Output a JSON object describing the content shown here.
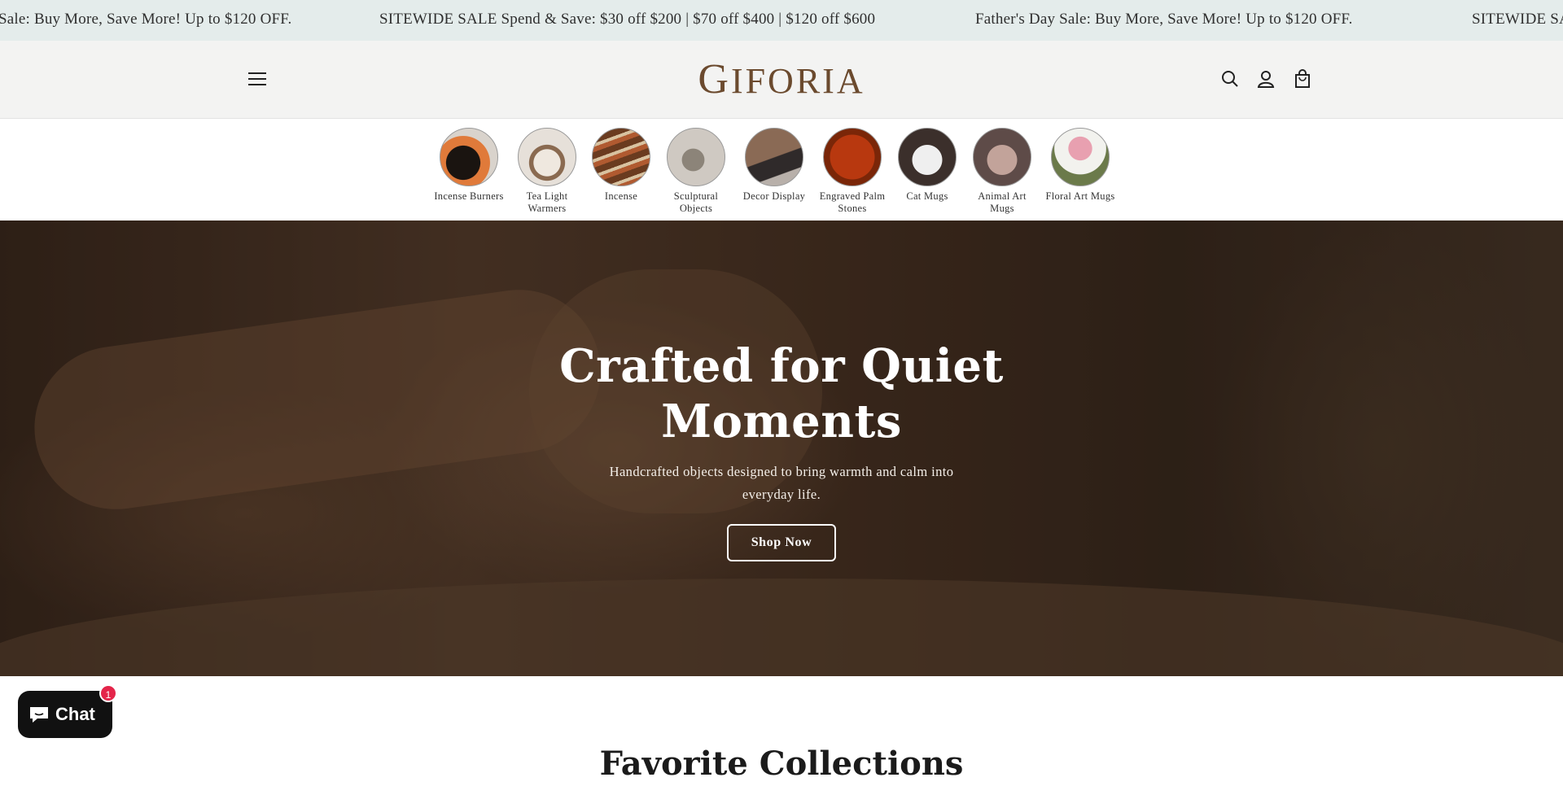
{
  "announcement": {
    "messages": [
      "Sale: Buy More, Save More! Up to $120 OFF.",
      "SITEWIDE SALE⁣ Spend & Save: $30 off $200 | $70 off $400 | $120 off $600",
      "⁣⁣⁣Father's Day Sale: Buy More, Save More! Up to $120 OFF.",
      "SITEWIDE SA"
    ]
  },
  "header": {
    "logo_first": "G",
    "logo_rest": "IFORIA",
    "icons": [
      "menu-icon",
      "search-icon",
      "account-icon",
      "cart-icon"
    ]
  },
  "categories": [
    {
      "label": "Incense Burners",
      "colors": [
        "#1a1410",
        "#e07a3a"
      ]
    },
    {
      "label": "Tea Light Warmers",
      "colors": [
        "#efe8df",
        "#8a6a50"
      ]
    },
    {
      "label": "Incense",
      "colors": [
        "#6a3b1f",
        "#b05a30"
      ]
    },
    {
      "label": "Sculptural Objects",
      "colors": [
        "#cfc9c2",
        "#8c8479"
      ]
    },
    {
      "label": "Decor Display",
      "colors": [
        "#8a6a55",
        "#2f2a2a"
      ]
    },
    {
      "label": "Engraved Palm Stones",
      "colors": [
        "#b8380f",
        "#7a2608"
      ]
    },
    {
      "label": "Cat Mugs",
      "colors": [
        "#3b2f2b",
        "#efefef"
      ]
    },
    {
      "label": "Animal Art Mugs",
      "colors": [
        "#5e4b48",
        "#c2a39a"
      ]
    },
    {
      "label": "Floral Art Mugs",
      "colors": [
        "#6b7a4a",
        "#e8a0b0"
      ]
    }
  ],
  "hero": {
    "title": "Crafted for Quiet Moments",
    "subtitle": "Handcrafted objects designed to bring warmth and calm into everyday life.",
    "button": "Shop Now"
  },
  "section": {
    "title": "Favorite Collections"
  },
  "chat": {
    "label": "Chat",
    "badge": "1"
  },
  "colors": {
    "announcement_bg": "#e4eceb",
    "header_bg": "#f3f3f2",
    "logo": "#6b4a2e",
    "badge": "#e4254a"
  }
}
